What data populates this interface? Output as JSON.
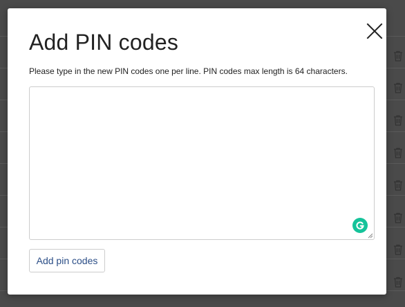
{
  "dialog": {
    "title": "Add PIN codes",
    "description": "Please type in the new PIN codes one per line. PIN codes max length is 64 characters.",
    "textarea_value": "",
    "submit_label": "Add pin codes"
  },
  "icons": {
    "close": "close-icon",
    "grammarly": "grammarly-icon",
    "resize": "resize-handle-icon",
    "background_row_action": "trash-icon"
  },
  "colors": {
    "overlay": "#4a4a4a",
    "modal_bg": "#ffffff",
    "button_text": "#2a4d86",
    "grammarly": "#15c39a",
    "border": "#cccccc"
  }
}
